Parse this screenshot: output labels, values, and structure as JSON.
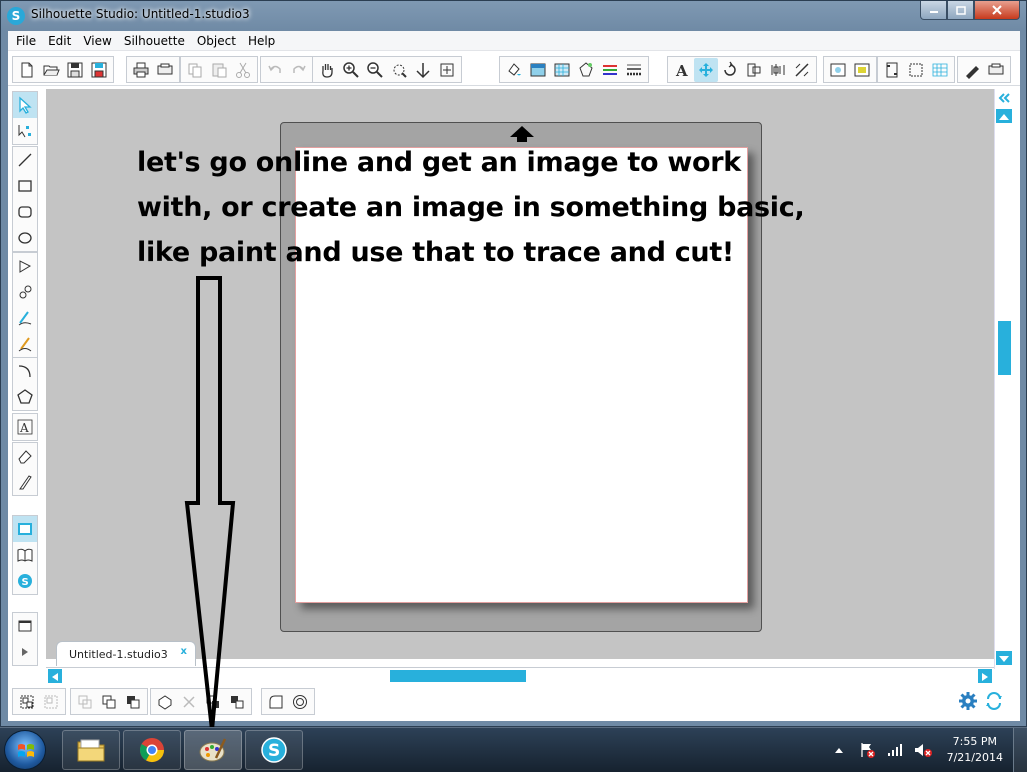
{
  "window": {
    "title": "Silhouette Studio: Untitled-1.studio3",
    "app_icon_letter": "S"
  },
  "menu": [
    "File",
    "Edit",
    "View",
    "Silhouette",
    "Object",
    "Help"
  ],
  "toolbar_icons": {
    "file": [
      "new-doc-icon",
      "open-folder-icon",
      "save-icon",
      "save-as-icon"
    ],
    "print": [
      "print-icon",
      "send-to-silhouette-icon"
    ],
    "clipboard": [
      "copy-icon",
      "paste-icon",
      "cut-icon"
    ],
    "history": [
      "undo-icon",
      "redo-icon"
    ],
    "view": [
      "pan-hand-icon",
      "zoom-in-icon",
      "zoom-out-icon",
      "zoom-select-icon",
      "zoom-drag-icon",
      "fit-page-icon"
    ],
    "panels": [
      "fill-color-icon",
      "gradient-icon",
      "pattern-icon",
      "line-color-icon",
      "line-style-icon",
      "line-weight-icon",
      "text-style-icon",
      "transform-icon",
      "replicate-icon",
      "modify-icon",
      "offset-icon",
      "trace-icon",
      "page-setup-icon",
      "cut-settings-icon",
      "registration-icon",
      "grid-icon",
      "library-icon",
      "send-icon"
    ]
  },
  "canvas": {
    "annotation": [
      "let's go online and get an image to work",
      "with, or create an image in something basic,",
      "like paint and use that to trace and cut!"
    ]
  },
  "doc_tab": {
    "label": "Untitled-1.studio3",
    "close": "x"
  },
  "taskbar": {
    "apps": [
      "file-explorer-icon",
      "chrome-icon",
      "paint-icon",
      "silhouette-studio-icon"
    ],
    "clock_time": "7:55 PM",
    "clock_date": "7/21/2014"
  },
  "colors": {
    "accent": "#28b0dc",
    "canvas_bg": "#c4c4c4",
    "mat": "#a4a4a4",
    "page_border": "#e4a0a0"
  }
}
